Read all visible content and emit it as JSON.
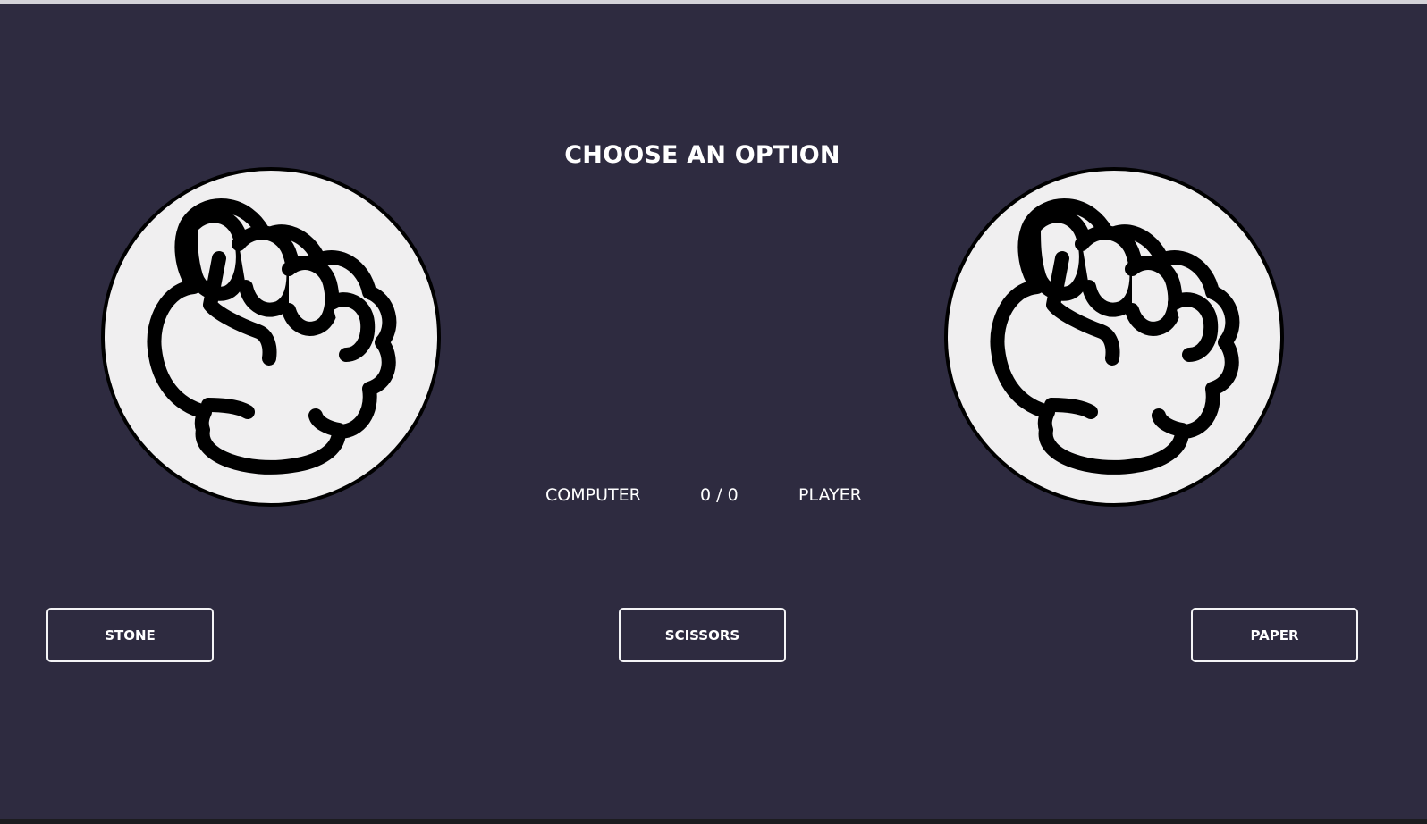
{
  "game": {
    "title": "CHOOSE AN OPTION",
    "computer_hand_icon": "raised-fist-icon",
    "player_hand_icon": "raised-fist-icon",
    "scoreboard": {
      "computer_label": "COMPUTER",
      "score": "0 / 0",
      "player_label": "PLAYER"
    },
    "buttons": {
      "stone": "STONE",
      "scissors": "SCISSORS",
      "paper": "PAPER"
    }
  },
  "colors": {
    "background": "#2e2b40",
    "circle_fill": "#f0eff0",
    "outline": "#000000",
    "text": "#ffffff"
  }
}
